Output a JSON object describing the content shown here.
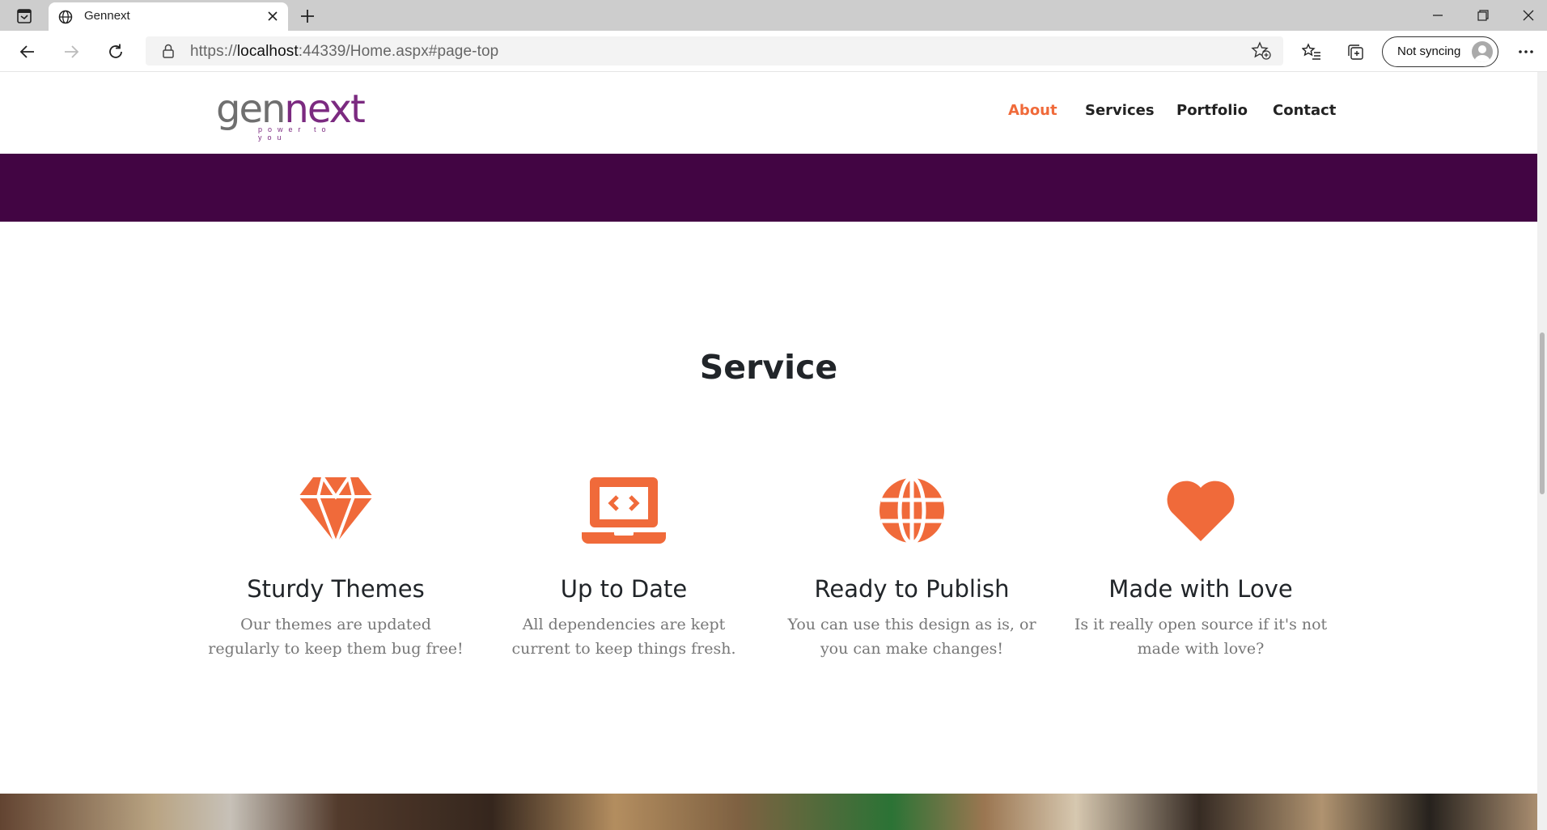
{
  "browser": {
    "tab_title": "Gennext",
    "url_prefix": "https://",
    "url_host": "localhost",
    "url_rest": ":44339/Home.aspx#page-top",
    "sync_label": "Not syncing"
  },
  "site": {
    "logo_gen": "gen",
    "logo_next": "next",
    "logo_tagline": "power to you",
    "nav": [
      {
        "label": "About"
      },
      {
        "label": "Services"
      },
      {
        "label": "Portfolio"
      },
      {
        "label": "Contact"
      }
    ],
    "section_title": "Service",
    "services": [
      {
        "icon": "gem-icon",
        "title": "Sturdy Themes",
        "line1": "Our themes are updated",
        "line2": "regularly to keep them bug free!"
      },
      {
        "icon": "laptop-code-icon",
        "title": "Up to Date",
        "line1": "All dependencies are kept",
        "line2": "current to keep things fresh."
      },
      {
        "icon": "globe-icon",
        "title": "Ready to Publish",
        "line1": "You can use this design as is, or",
        "line2": "you can make changes!"
      },
      {
        "icon": "heart-icon",
        "title": "Made with Love",
        "line1": "Is it really open source if it's not",
        "line2": "made with love?"
      }
    ],
    "colors": {
      "accent": "#f06a3a",
      "band": "#420543",
      "logo_purple": "#7b2a80"
    }
  }
}
